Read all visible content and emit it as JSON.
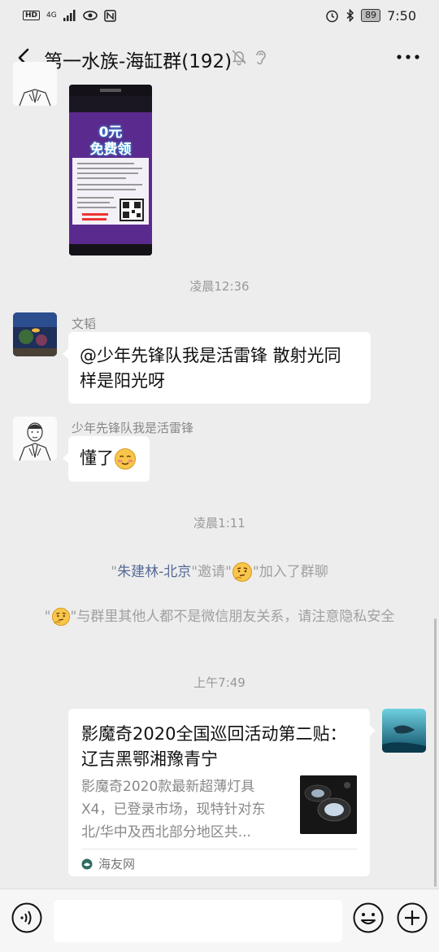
{
  "status_bar": {
    "hd": "HD",
    "network": "4G",
    "battery": "89",
    "time": "7:50"
  },
  "header": {
    "title": "第一水族-海缸群(192)"
  },
  "messages": {
    "ts1": "凌晨12:36",
    "m1_sender": "文韬",
    "m1_line1": "@少年先锋队我是活雷锋  散射光同",
    "m1_line2": "样是阳光呀",
    "m2_sender": "少年先锋队我是活雷锋",
    "m2_text": "懂了",
    "ts2": "凌晨1:11",
    "sys1_quote_open": "\"",
    "sys1_name": "朱建林-北京",
    "sys1_mid": "\"邀请\"",
    "sys1_end": "\"加入了群聊",
    "sys2_quote_open": "\"",
    "sys2_text": "\"与群里其他人都不是微信朋友关系，请注意隐私安全",
    "ts3": "上午7:49"
  },
  "shared_image": {
    "banner_line1": "0元",
    "banner_line2": "免费领"
  },
  "link_card": {
    "title": "影魔奇2020全国巡回活动第二贴：  辽吉黑鄂湘豫青宁",
    "desc": "影魔奇2020款最新超薄灯具X4，已登录市场，现特针对东北/华中及西北部分地区共...",
    "source": "海友网"
  },
  "colors": {
    "background": "#ededed",
    "bubble": "#ffffff",
    "link_blue": "#576b95",
    "system_text": "#a0a0a0"
  }
}
